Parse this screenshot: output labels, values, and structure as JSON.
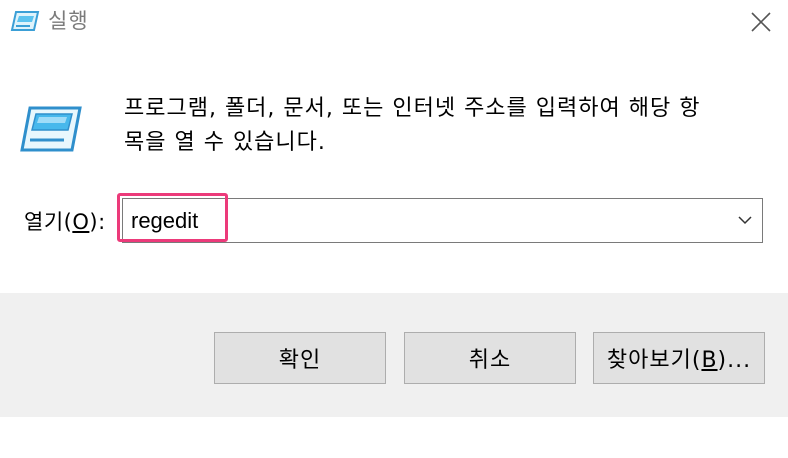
{
  "window": {
    "title": "실행"
  },
  "dialog": {
    "description_line1": "프로그램, 폴더, 문서, 또는 인터넷 주소를 입력하여 해당 항",
    "description_line2": "목을 열 수 있습니다.",
    "open_label_prefix": "열기(",
    "open_label_mnemonic": "O",
    "open_label_suffix": "):",
    "open_value": "regedit"
  },
  "buttons": {
    "ok": "확인",
    "cancel": "취소",
    "browse_prefix": "찾아보기(",
    "browse_mnemonic": "B",
    "browse_suffix": ")..."
  },
  "icons": {
    "title": "run-icon",
    "main": "run-large-icon",
    "close": "close-icon",
    "dropdown": "chevron-down-icon"
  },
  "colors": {
    "highlight": "#ec3a7a",
    "footer_bg": "#f0f0f0",
    "button_bg": "#e1e1e1"
  }
}
